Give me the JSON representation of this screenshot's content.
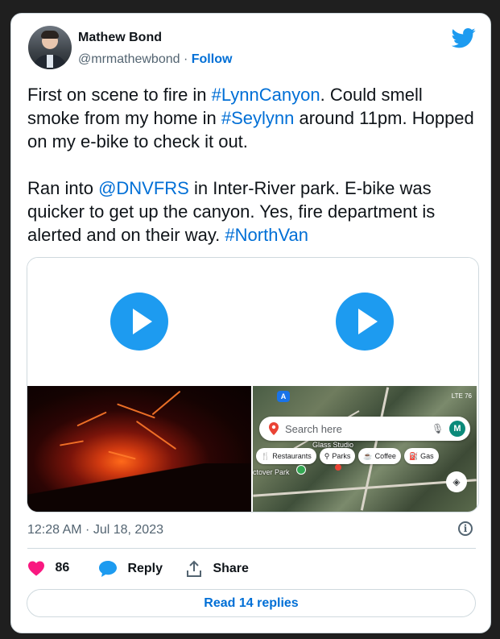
{
  "author": {
    "name": "Mathew Bond",
    "handle": "@mrmathewbond",
    "separator": "·",
    "follow_label": "Follow"
  },
  "tweet": {
    "para1": {
      "t1": "First on scene to fire in ",
      "tag1": "#LynnCanyon",
      "t2": ". Could smell smoke from my home in ",
      "tag2": "#Seylynn",
      "t3": " around 11pm. Hopped on my e-bike to check it out."
    },
    "para2": {
      "t1": "Ran into ",
      "mention": "@DNVFRS",
      "t2": " in Inter-River park. E-bike was quicker to get up the canyon. Yes, fire department is alerted and on their way. ",
      "tag": "#NorthVan"
    }
  },
  "media": {
    "map": {
      "search_placeholder": "Search here",
      "avatar_letter": "M",
      "top_badge": "A",
      "status": "LTE 76",
      "chips": [
        "Restaurants",
        "Parks",
        "Coffee",
        "Gas"
      ],
      "label_studio": "Glass Studio",
      "label_park": "ctover Park"
    }
  },
  "timestamp": "12:28 AM · Jul 18, 2023",
  "actions": {
    "like_count": "86",
    "reply_label": "Reply",
    "share_label": "Share"
  },
  "read_replies_label": "Read 14 replies",
  "colors": {
    "accent": "#1d9bf0",
    "link": "#006fd6",
    "like": "#f91880",
    "text": "#0f1419",
    "muted": "#536471"
  },
  "icons": [
    "twitter-bird-icon",
    "play-icon",
    "info-icon",
    "heart-icon",
    "reply-bubble-icon",
    "share-icon"
  ]
}
